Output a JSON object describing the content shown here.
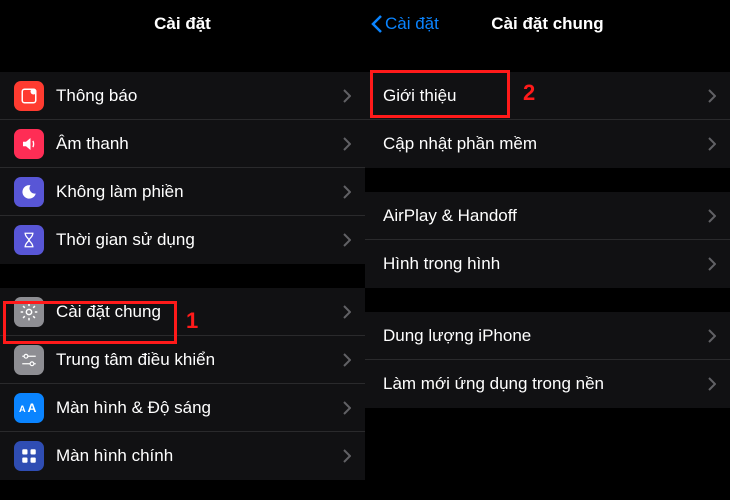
{
  "left": {
    "title": "Cài đặt",
    "group1": [
      {
        "label": "Thông báo"
      },
      {
        "label": "Âm thanh"
      },
      {
        "label": "Không làm phiền"
      },
      {
        "label": "Thời gian sử dụng"
      }
    ],
    "group2": [
      {
        "label": "Cài đặt chung"
      },
      {
        "label": "Trung tâm điều khiển"
      },
      {
        "label": "Màn hình & Độ sáng"
      },
      {
        "label": "Màn hình chính"
      }
    ],
    "annotation1": "1"
  },
  "right": {
    "back": "Cài đặt",
    "title": "Cài đặt chung",
    "group1": [
      {
        "label": "Giới thiệu"
      },
      {
        "label": "Cập nhật phần mềm"
      }
    ],
    "group2": [
      {
        "label": "AirPlay & Handoff"
      },
      {
        "label": "Hình trong hình"
      }
    ],
    "group3": [
      {
        "label": "Dung lượng iPhone"
      },
      {
        "label": "Làm mới ứng dụng trong nền"
      }
    ],
    "annotation2": "2"
  }
}
